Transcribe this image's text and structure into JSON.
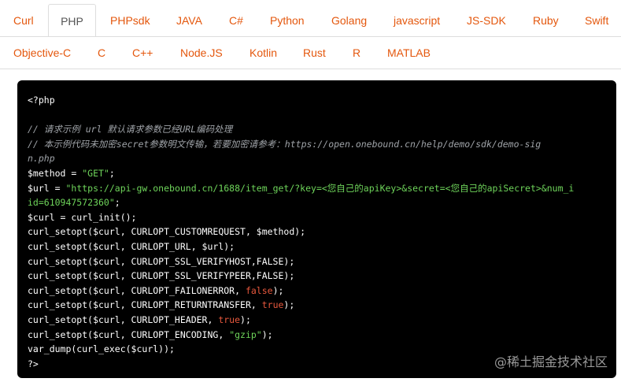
{
  "tabs": {
    "row1": [
      "Curl",
      "PHP",
      "PHPsdk",
      "JAVA",
      "C#",
      "Python",
      "Golang",
      "javascript",
      "JS-SDK",
      "Ruby",
      "Swift"
    ],
    "row2": [
      "Objective-C",
      "C",
      "C++",
      "Node.JS",
      "Kotlin",
      "Rust",
      "R",
      "MATLAB"
    ],
    "active": "PHP"
  },
  "colors": {
    "tab_link": "#e4570d",
    "tab_active": "#555555",
    "code_bg": "#000000",
    "code_text": "#ffffff",
    "comment": "#9fa3a8",
    "string": "#6ed45a",
    "keyword_bool": "#e8583d"
  },
  "code": {
    "open_tag": "<?php",
    "comment1": "// 请求示例 url 默认请求参数已经URL编码处理",
    "comment2a": "// 本示例代码未加密secret参数明文传输，若要加密请参考：https://open.onebound.cn/help/demo/sdk/demo-sig",
    "comment2b": "n.php",
    "method_prefix": "$method = ",
    "method_value": "\"GET\"",
    "semicolon": ";",
    "url_prefix": "$url = ",
    "url_value_a": "\"https://api-gw.onebound.cn/1688/item_get/?key=<您自己的apiKey>&secret=<您自己的apiSecret>&num_i",
    "url_value_b": "id=610947572360\"",
    "curl_init": "$curl = curl_init();",
    "opt_customrequest": "curl_setopt($curl, CURLOPT_CUSTOMREQUEST, $method);",
    "opt_url": "curl_setopt($curl, CURLOPT_URL, $url);",
    "opt_verifyhost": "curl_setopt($curl, CURLOPT_SSL_VERIFYHOST,FALSE);",
    "opt_verifypeer": "curl_setopt($curl, CURLOPT_SSL_VERIFYPEER,FALSE);",
    "opt_failonerror_prefix": "curl_setopt($curl, CURLOPT_FAILONERROR, ",
    "false_kw": "false",
    "opt_returntransfer_prefix": "curl_setopt($curl, CURLOPT_RETURNTRANSFER, ",
    "true_kw": "true",
    "opt_header_prefix": "curl_setopt($curl, CURLOPT_HEADER, ",
    "opt_encoding_prefix": "curl_setopt($curl, CURLOPT_ENCODING, ",
    "gzip_value": "\"gzip\"",
    "close_paren_semicolon": ");",
    "var_dump": "var_dump(curl_exec($curl));",
    "close_tag": "?>"
  },
  "watermark": "@稀土掘金技术社区"
}
